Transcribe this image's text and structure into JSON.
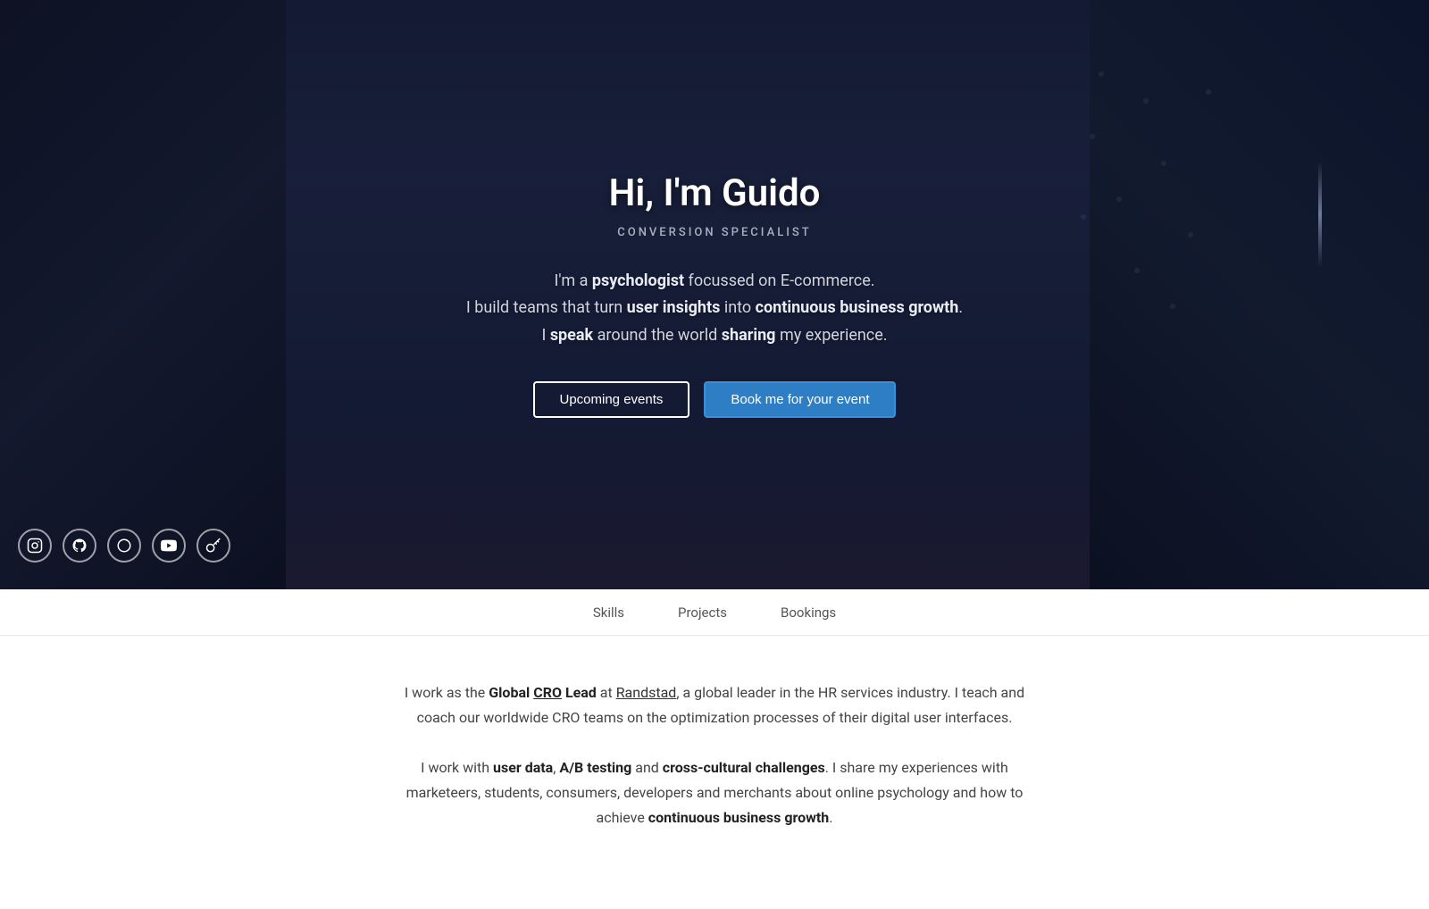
{
  "hero": {
    "title": "Hi, I'm Guido",
    "subtitle": "CONVERSION SPECIALIST",
    "description_line1_pre": "I'm a ",
    "description_line1_bold": "psychologist",
    "description_line1_post": " focussed on E-commerce.",
    "description_line2_pre": "I build teams that turn ",
    "description_line2_bold1": "user insights",
    "description_line2_mid": " into ",
    "description_line2_bold2": "continuous business growth",
    "description_line2_post": ".",
    "description_line3_pre": "I ",
    "description_line3_bold1": "speak",
    "description_line3_mid": " around the world ",
    "description_line3_bold2": "sharing",
    "description_line3_post": " my experience.",
    "btn_upcoming": "Upcoming events",
    "btn_book": "Book me for your event"
  },
  "social": [
    {
      "name": "instagram",
      "icon": "instagram-icon",
      "symbol": "📷"
    },
    {
      "name": "github",
      "icon": "github-icon",
      "symbol": "⚙"
    },
    {
      "name": "circle",
      "icon": "circle-icon",
      "symbol": "○"
    },
    {
      "name": "youtube",
      "icon": "youtube-icon",
      "symbol": "▶"
    },
    {
      "name": "key",
      "icon": "key-icon",
      "symbol": "🔑"
    }
  ],
  "nav": {
    "items": [
      {
        "label": "Skills",
        "id": "nav-skills"
      },
      {
        "label": "Projects",
        "id": "nav-projects"
      },
      {
        "label": "Bookings",
        "id": "nav-bookings"
      }
    ]
  },
  "content": {
    "para1_pre": "I work as the ",
    "para1_bold1": "Global ",
    "para1_bold2": "CRO",
    "para1_bold3": " Lead",
    "para1_mid": " at ",
    "para1_link": "Randstad",
    "para1_post": ", a global leader in the HR services industry. I teach and coach our worldwide CRO teams on the optimization processes of their digital user interfaces.",
    "para2_pre": "I work with ",
    "para2_bold1": "user data",
    "para2_mid1": ", ",
    "para2_bold2": "A/B testing",
    "para2_mid2": " and ",
    "para2_bold3": "cross-cultural challenges",
    "para2_post": ". I share my experiences with marketeers, students, consumers, developers and merchants about online psychology and how to achieve ",
    "para2_bold4": "continuous business growth",
    "para2_end": "."
  }
}
